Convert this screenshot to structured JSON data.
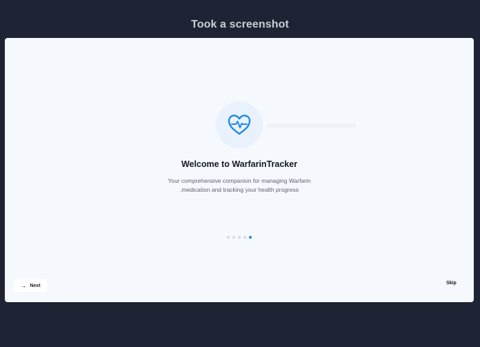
{
  "header": {
    "title": "Took a screenshot"
  },
  "onboarding": {
    "icon": "heart-pulse-icon",
    "title": "Welcome to WarfarinTracker",
    "description_lines": [
      "Your comprehensive companion for managing Warfarin",
      ".medication and tracking your health progress"
    ],
    "page_count": 5,
    "current_page": 5
  },
  "actions": {
    "next_label": "Next",
    "skip_label": "Skip"
  },
  "colors": {
    "accent": "#1e88e5",
    "background": "#1e2433",
    "card": "#f5f8fc"
  }
}
